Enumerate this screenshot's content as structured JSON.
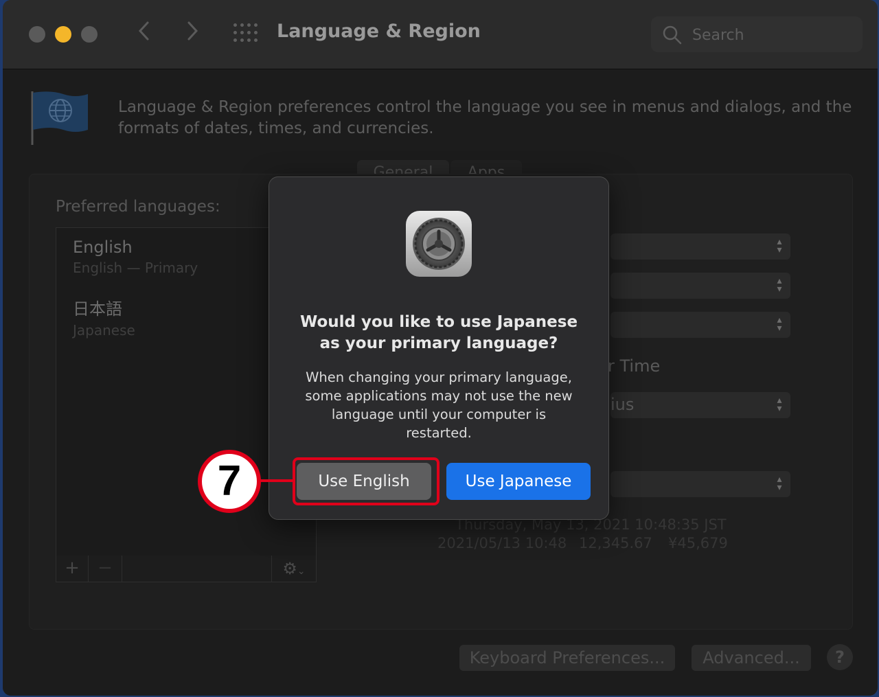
{
  "window": {
    "title": "Language & Region",
    "search_placeholder": "Search",
    "description": "Language & Region preferences control the language you see in menus and dialogs, and the formats of dates, times, and currencies."
  },
  "tabs": [
    {
      "label": "General"
    },
    {
      "label": "Apps"
    }
  ],
  "preferred_languages": {
    "label": "Preferred languages:",
    "items": [
      {
        "name": "English",
        "sub": "English — Primary"
      },
      {
        "name": "日本語",
        "sub": "Japanese"
      }
    ],
    "add_label": "+",
    "remove_label": "−"
  },
  "settings": {
    "partial_time_label": "r Time",
    "partial_temp_value": "ius"
  },
  "sample": {
    "line1": "Thursday, May 13, 2021 10:48:35 JST",
    "date_short": "2021/05/13 10:48",
    "number": "12,345.67",
    "currency": "¥45,679"
  },
  "footer": {
    "keyboard_button": "Keyboard Preferences...",
    "advanced_button": "Advanced...",
    "help_button": "?"
  },
  "dialog": {
    "title_line1": "Would you like to use Japanese",
    "title_line2": "as your primary language?",
    "message_line1": "When changing your primary language,",
    "message_line2": "some applications may not use the new",
    "message_line3": "language until your computer is",
    "message_line4": "restarted.",
    "use_english_label": "Use English",
    "use_japanese_label": "Use Japanese"
  },
  "annotation": {
    "step_number": "7",
    "highlight_color": "#e0001a"
  },
  "colors": {
    "accent": "#1a72e8",
    "minimize_light": "#f4b62a"
  }
}
